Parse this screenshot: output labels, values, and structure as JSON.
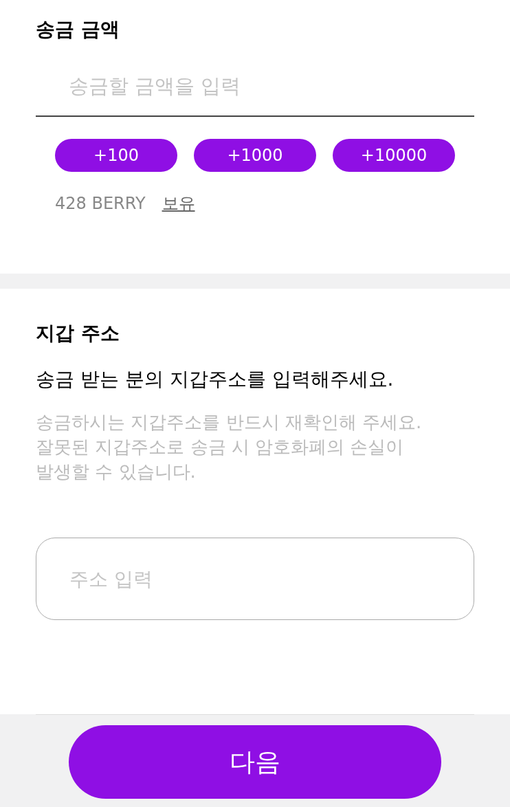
{
  "amount_section": {
    "title": "송금 금액",
    "amount_input": {
      "placeholder": "송금할 금액을 입력"
    },
    "quick_add_buttons": [
      "+100",
      "+1000",
      "+10000"
    ],
    "balance": {
      "amount": "428 BERRY",
      "link": "보유"
    }
  },
  "wallet_section": {
    "title": "지갑 주소",
    "instruction": "송금 받는 분의 지갑주소를 입력해주세요.",
    "warning": "송금하시는 지갑주소를 반드시 재확인해 주세요.\n잘못된 지갑주소로 송금 시 암호화폐의 손실이\n발생할 수 있습니다.",
    "address_input": {
      "placeholder": "주소 입력"
    }
  },
  "next_button": "다음"
}
